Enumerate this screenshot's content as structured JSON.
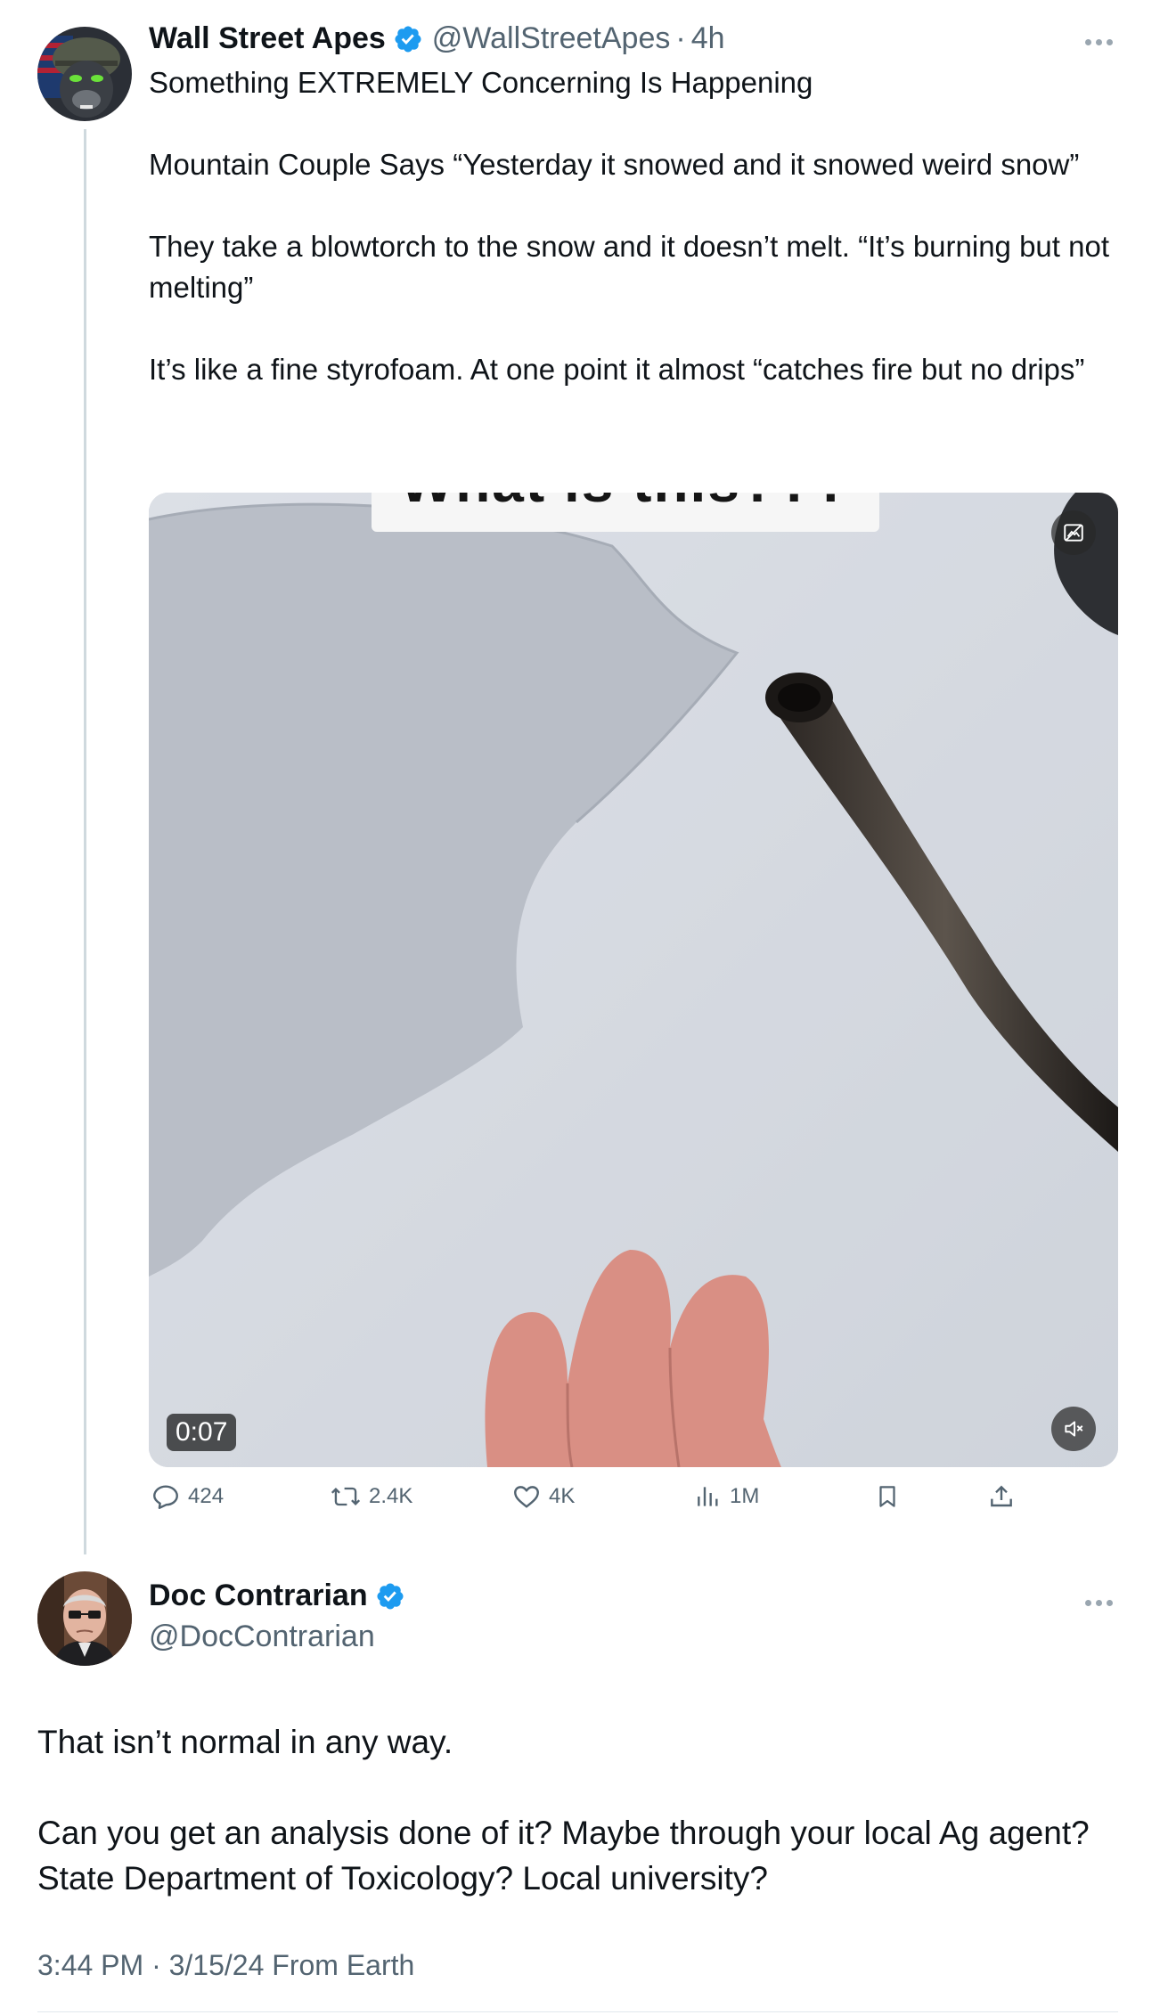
{
  "tweet": {
    "author_name": "Wall Street Apes",
    "author_handle": "@WallStreetApes",
    "separator": "·",
    "age": "4h",
    "text": "Something EXTREMELY Concerning Is Happening\n\nMountain Couple Says “Yesterday it snowed and it snowed weird snow”\n\nThey take a blowtorch to the snow and it doesn’t melt. “It’s burning but not melting”\n\nIt’s like a fine styrofoam. At one point it almost “catches fire but no drips”",
    "video": {
      "caption_overlay": "What is this???",
      "duration": "0:07"
    },
    "stats": {
      "replies": "424",
      "reposts": "2.4K",
      "likes": "4K",
      "views": "1M"
    }
  },
  "reply": {
    "author_name": "Doc Contrarian",
    "author_handle": "@DocContrarian",
    "text": "That isn’t normal in any way.\n\nCan you get an analysis done of it? Maybe through your local Ag agent? State Department of Toxicology? Local university?",
    "timestamp": "3:44 PM · 3/15/24 From Earth"
  },
  "colors": {
    "verified": "#1d9bf0",
    "secondary_text": "#536471",
    "thread_line": "#cfd9de"
  }
}
